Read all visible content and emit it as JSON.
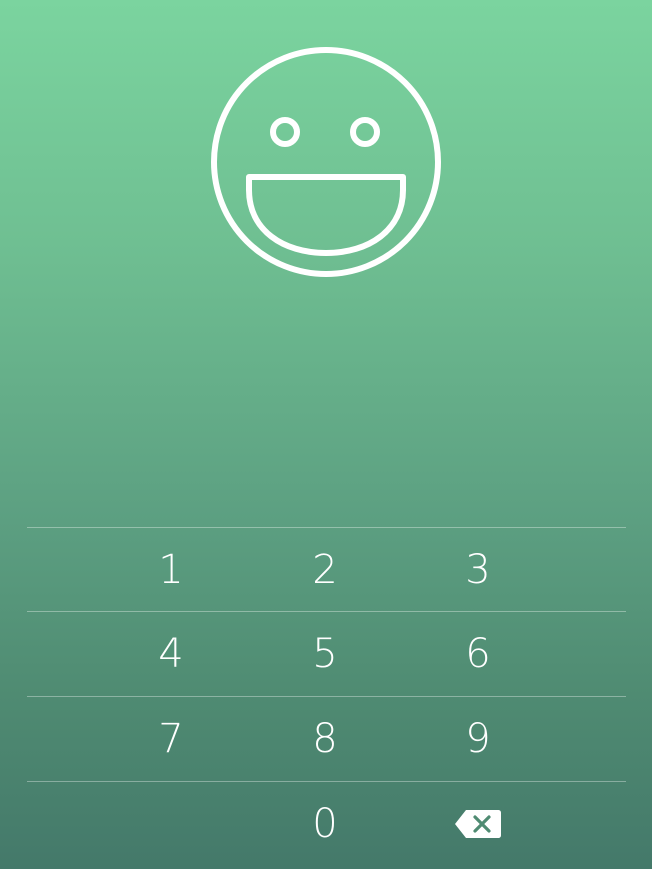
{
  "screen": {
    "background_top": "#7bd49f",
    "background_bottom": "#44796a",
    "accent": "#ffffff"
  },
  "header": {
    "icon": "smiley-face-icon"
  },
  "keypad": {
    "rows": [
      [
        "1",
        "2",
        "3"
      ],
      [
        "4",
        "5",
        "6"
      ],
      [
        "7",
        "8",
        "9"
      ],
      [
        "",
        "0",
        "backspace"
      ]
    ],
    "backspace_icon": "backspace-icon"
  }
}
